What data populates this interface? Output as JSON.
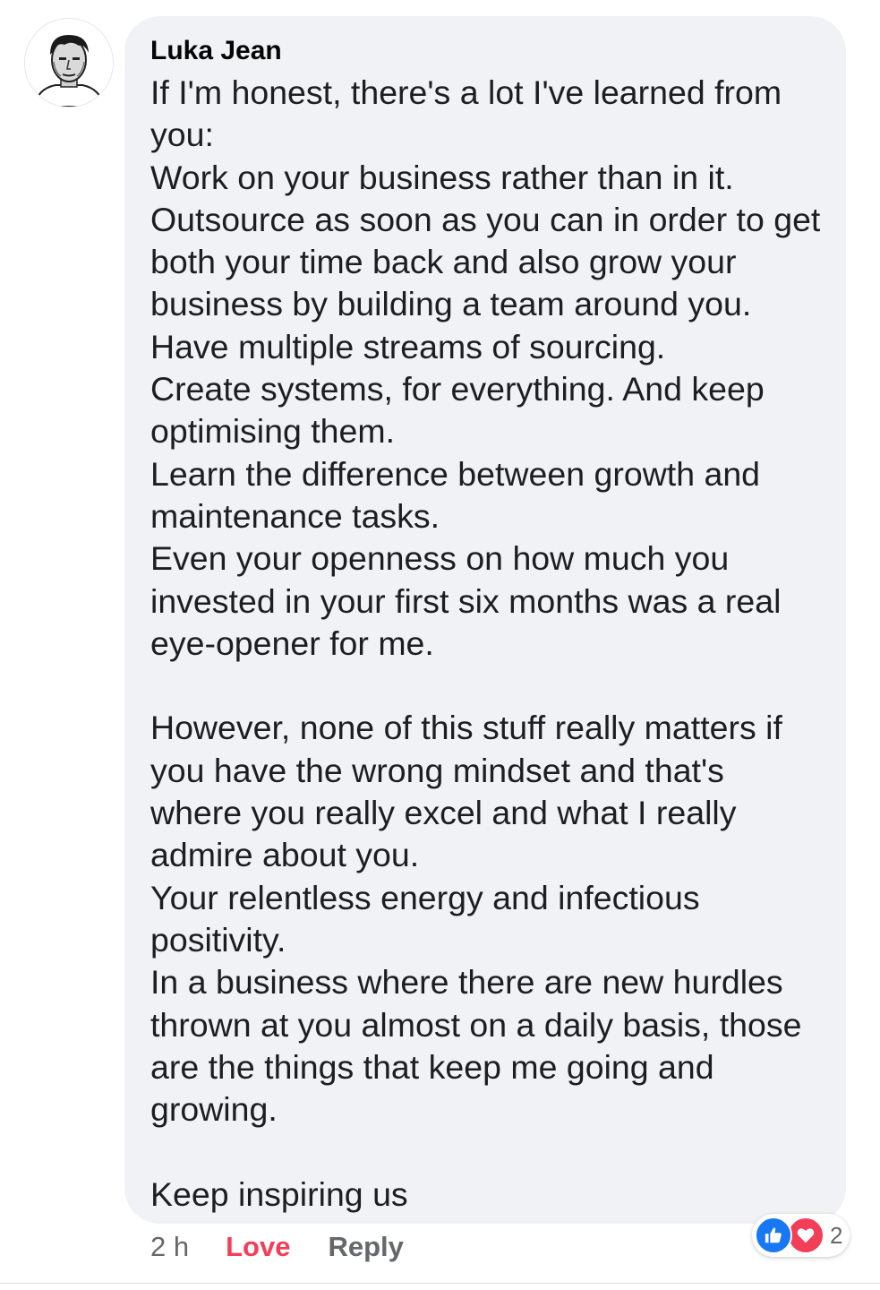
{
  "comment": {
    "author": "Luka Jean",
    "paragraphs": [
      "If I'm honest, there's a lot I've learned from you:\nWork on your business rather than in it.\nOutsource as soon as you can in order to get both your time back and also grow your business by building a team around you.\nHave multiple streams of sourcing.\nCreate systems, for everything. And keep optimising them.\nLearn the difference between growth and maintenance tasks.\nEven your openness on how much you invested in your first six months was a real eye-opener for me.",
      "However, none of this stuff really matters if you have the wrong mindset and that's where you really excel and what I really admire about you.\nYour relentless energy and infectious positivity.\nIn a business where there are new hurdles thrown at you almost on a daily basis, those are the things that keep me going and growing.",
      "Keep inspiring us"
    ]
  },
  "footer": {
    "timestamp": "2 h",
    "love_label": "Love",
    "reply_label": "Reply"
  },
  "reactions": {
    "icons": [
      "like-icon",
      "heart-icon"
    ],
    "count": "2"
  },
  "colors": {
    "bubble_background": "#f0f2f5",
    "love_active": "#f33e58",
    "like_blue": "#1877f2",
    "meta_gray": "#65676b"
  }
}
